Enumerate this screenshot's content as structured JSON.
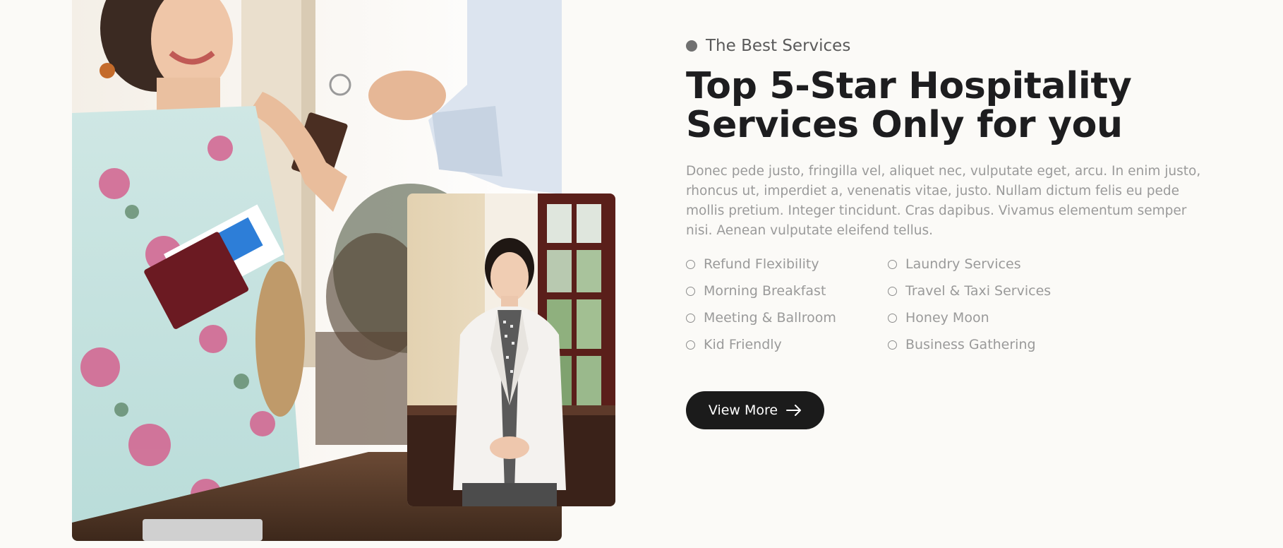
{
  "section": {
    "eyebrow": "The Best Services",
    "headline_line1": "Top 5-Star Hospitality",
    "headline_line2": "Services Only for you",
    "description": "Donec pede justo, fringilla vel, aliquet nec, vulputate eget, arcu. In enim justo, rhoncus ut, imperdiet a, venenatis vitae, justo. Nullam dictum felis eu pede mollis pretium. Integer tincidunt. Cras dapibus. Vivamus elementum semper nisi. Aenean vulputate eleifend tellus.",
    "features": [
      "Refund Flexibility",
      "Laundry Services",
      "Morning Breakfast",
      "Travel & Taxi Services",
      "Meeting & Ballroom",
      "Honey Moon",
      "Kid Friendly",
      "Business Gathering"
    ],
    "cta_label": "View More"
  },
  "images": {
    "main": "photo-guest-receiving-room-key",
    "inset": "photo-hotel-receptionist"
  },
  "colors": {
    "background": "#fbfaf7",
    "heading": "#1d1d1f",
    "body_text": "#9a9a9a",
    "button": "#1b1b1b"
  }
}
